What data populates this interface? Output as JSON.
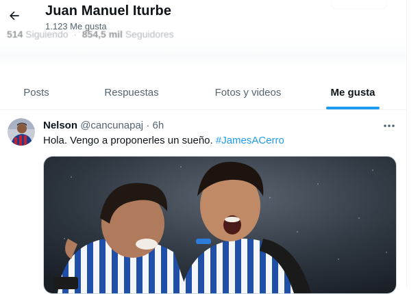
{
  "header": {
    "title": "Juan Manuel Iturbe",
    "subtitle": "1.123 Me gusta",
    "back_icon": "arrow-left-icon",
    "ghost_following_count": "514",
    "ghost_following_label": "Siguiendo",
    "ghost_followers_count": "854,5 mil",
    "ghost_followers_label": "Seguidores"
  },
  "tabs": [
    {
      "label": "Posts",
      "active": false
    },
    {
      "label": "Respuestas",
      "active": false
    },
    {
      "label": "Fotos y videos",
      "active": false
    },
    {
      "label": "Me gusta",
      "active": true
    }
  ],
  "tweet": {
    "author_name": "Nelson",
    "handle": "@cancunapaj",
    "separator": "·",
    "time": "6h",
    "text": "Hola. Vengo a proponerles un sueño. ",
    "hashtag": "#JamesACerro",
    "more_icon": "more-horizontal-icon",
    "media_icon": "photo"
  },
  "colors": {
    "accent": "#1d9bf0",
    "text_primary": "#0f1419",
    "text_secondary": "#536471",
    "border": "#eff3f4"
  }
}
